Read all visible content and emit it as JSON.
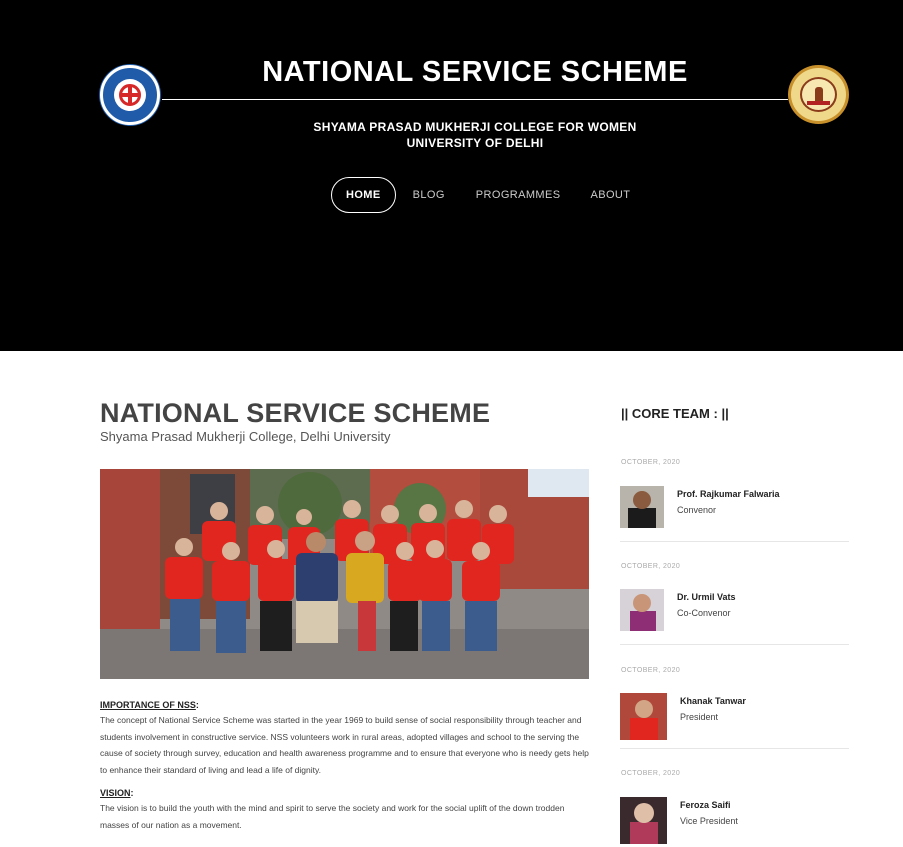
{
  "header": {
    "title": "NATIONAL SERVICE SCHEME",
    "college": "SHYAMA PRASAD MUKHERJI COLLEGE FOR WOMEN",
    "university": "UNIVERSITY OF DELHI",
    "left_logo": "nss-logo",
    "right_logo": "college-emblem-logo"
  },
  "nav": {
    "items": [
      {
        "label": "HOME"
      },
      {
        "label": "BLOG"
      },
      {
        "label": "PROGRAMMES"
      },
      {
        "label": "ABOUT"
      }
    ]
  },
  "main": {
    "title": "NATIONAL SERVICE SCHEME",
    "subtitle": "Shyama Prasad Mukherji College, Delhi University",
    "importance_heading": "IMPORTANCE OF NSS",
    "importance_text": "The concept of National Service Scheme was started in the year 1969 to build sense of social responsibility through teacher and students involvement in constructive service. NSS volunteers work in rural areas, adopted villages and school to the serving the cause of society through survey, education and health awareness programme and to ensure that everyone who is needy gets help to enhance their standard of living and lead a life of dignity.",
    "vision_heading": "VISION",
    "vision_text": "The vision is to build the youth with the mind and spirit to serve the society and work for the social uplift of the down trodden masses of our nation as a movement.",
    "colon": ":"
  },
  "sidebar": {
    "title": "|| CORE TEAM : ||",
    "members": [
      {
        "date": "OCTOBER, 2020",
        "name": "Prof. Rajkumar Falwaria",
        "role": "Convenor"
      },
      {
        "date": "OCTOBER, 2020",
        "name": "Dr. Urmil Vats",
        "role": "Co-Convenor"
      },
      {
        "date": "OCTOBER, 2020",
        "name": "Khanak Tanwar",
        "role": "President"
      },
      {
        "date": "OCTOBER, 2020",
        "name": "Feroza Saifi",
        "role": "Vice President"
      }
    ]
  },
  "colors": {
    "header_bg": "#000000",
    "nss_blue": "#1f5ba8",
    "tshirt_red": "#e0261f"
  }
}
